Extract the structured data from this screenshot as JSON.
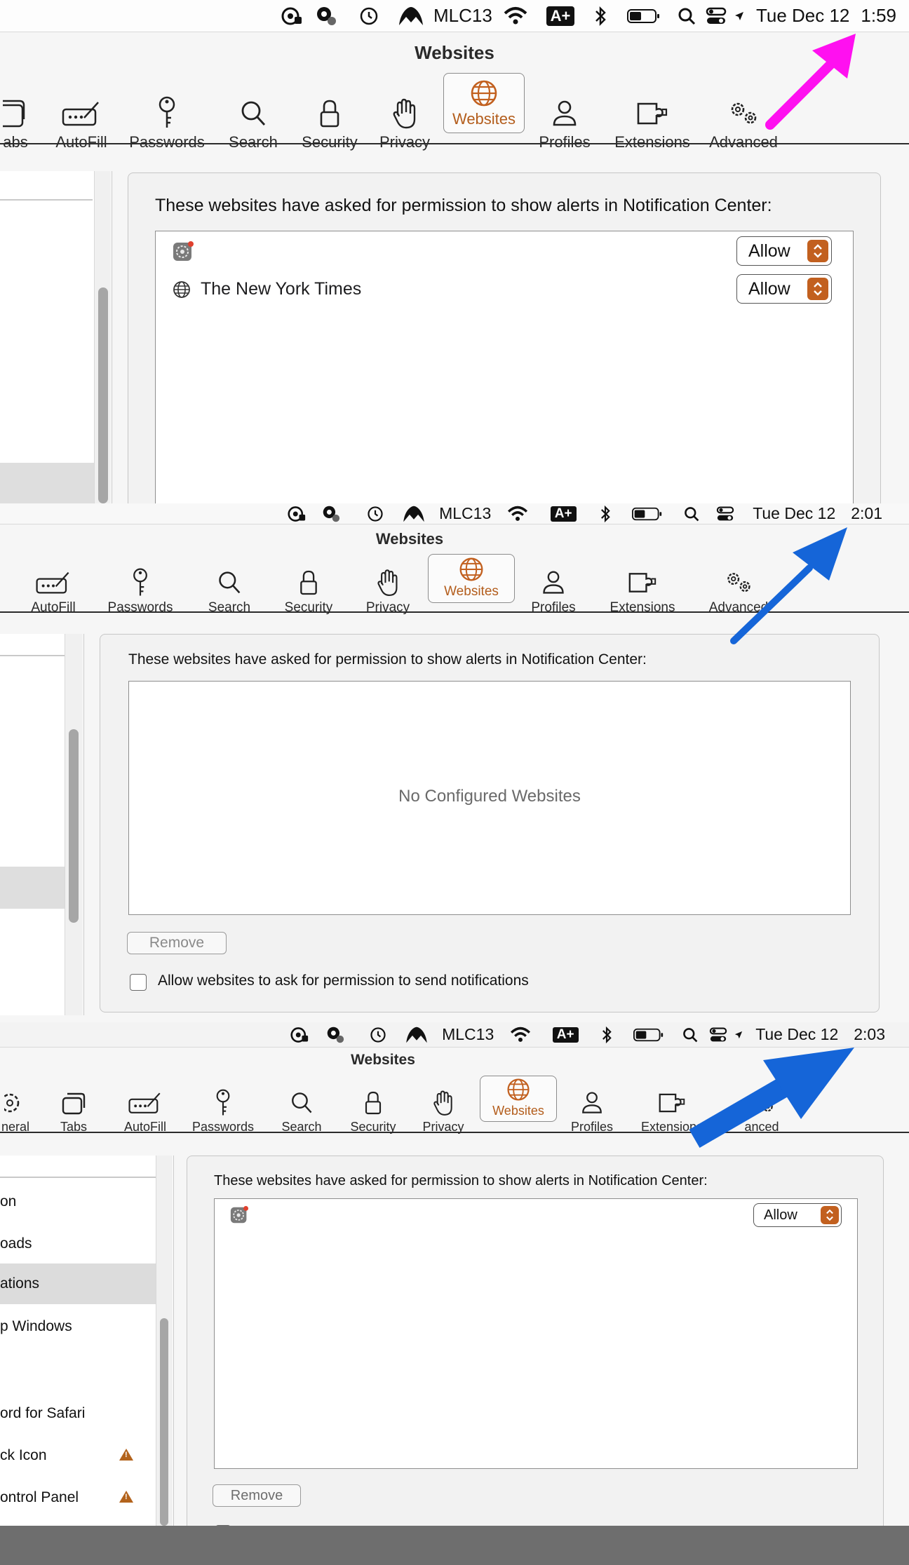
{
  "screens": [
    {
      "menubar": {
        "vpn_label": "MLC13",
        "input_label": "A+",
        "date": "Tue Dec 12",
        "time": "1:59",
        "icons": [
          "privacy-lock-icon",
          "location-pin-icon",
          "time-machine-icon",
          "nordvpn-mountain-icon",
          "wifi-icon",
          "input-source-icon",
          "bluetooth-icon",
          "battery-icon",
          "spotlight-search-icon",
          "control-center-icon",
          "location-arrow-icon"
        ]
      },
      "window_title": "Websites",
      "toolbar": [
        "abs",
        "AutoFill",
        "Passwords",
        "Search",
        "Security",
        "Privacy",
        "Websites",
        "Profiles",
        "Extensions",
        "Advanced"
      ],
      "selected_tab": "Websites",
      "notice": "These websites have asked for permission to show alerts in Notification Center:",
      "sites": [
        {
          "name": "",
          "icon": "system-settings-icon",
          "permission": "Allow"
        },
        {
          "name": "The New York Times",
          "icon": "globe-icon",
          "permission": "Allow"
        }
      ],
      "arrow_color": "#ff10f0"
    },
    {
      "menubar": {
        "vpn_label": "MLC13",
        "input_label": "A+",
        "date": "Tue Dec 12",
        "time": "2:01",
        "icons": [
          "privacy-lock-icon",
          "location-pin-icon",
          "time-machine-icon",
          "nordvpn-mountain-icon",
          "wifi-icon",
          "input-source-icon",
          "bluetooth-icon",
          "battery-icon",
          "spotlight-search-icon",
          "control-center-icon"
        ]
      },
      "window_title": "Websites",
      "toolbar": [
        "AutoFill",
        "Passwords",
        "Search",
        "Security",
        "Privacy",
        "Websites",
        "Profiles",
        "Extensions",
        "Advanced"
      ],
      "selected_tab": "Websites",
      "notice": "These websites have asked for permission to show alerts in Notification Center:",
      "empty_message": "No Configured Websites",
      "remove_label": "Remove",
      "checkbox_label": "Allow websites to ask for permission to send notifications",
      "checkbox_checked": false,
      "arrow_color": "#1565d8"
    },
    {
      "menubar": {
        "vpn_label": "MLC13",
        "input_label": "A+",
        "date": "Tue Dec 12",
        "time": "2:03",
        "icons": [
          "privacy-lock-icon",
          "location-pin-icon",
          "time-machine-icon",
          "nordvpn-mountain-icon",
          "wifi-icon",
          "input-source-icon",
          "bluetooth-icon",
          "battery-icon",
          "spotlight-search-icon",
          "control-center-icon",
          "location-arrow-icon"
        ]
      },
      "window_title": "Websites",
      "toolbar": [
        "neral",
        "Tabs",
        "AutoFill",
        "Passwords",
        "Search",
        "Security",
        "Privacy",
        "Websites",
        "Profiles",
        "Extensions",
        "anced"
      ],
      "selected_tab": "Websites",
      "sidebar_items": [
        {
          "label": "on",
          "warning": false,
          "selected": false
        },
        {
          "label": "oads",
          "warning": false,
          "selected": false
        },
        {
          "label": "ations",
          "warning": false,
          "selected": true
        },
        {
          "label": "p Windows",
          "warning": false,
          "selected": false
        },
        {
          "label": "ord for Safari",
          "warning": false,
          "selected": false
        },
        {
          "label": "ck Icon",
          "warning": true,
          "selected": false
        },
        {
          "label": "ontrol Panel",
          "warning": true,
          "selected": false
        }
      ],
      "notice": "These websites have asked for permission to show alerts in Notification Center:",
      "sites": [
        {
          "name": "",
          "icon": "system-settings-icon",
          "permission": "Allow"
        }
      ],
      "remove_label": "Remove",
      "arrow_color": "#1565d8"
    }
  ]
}
